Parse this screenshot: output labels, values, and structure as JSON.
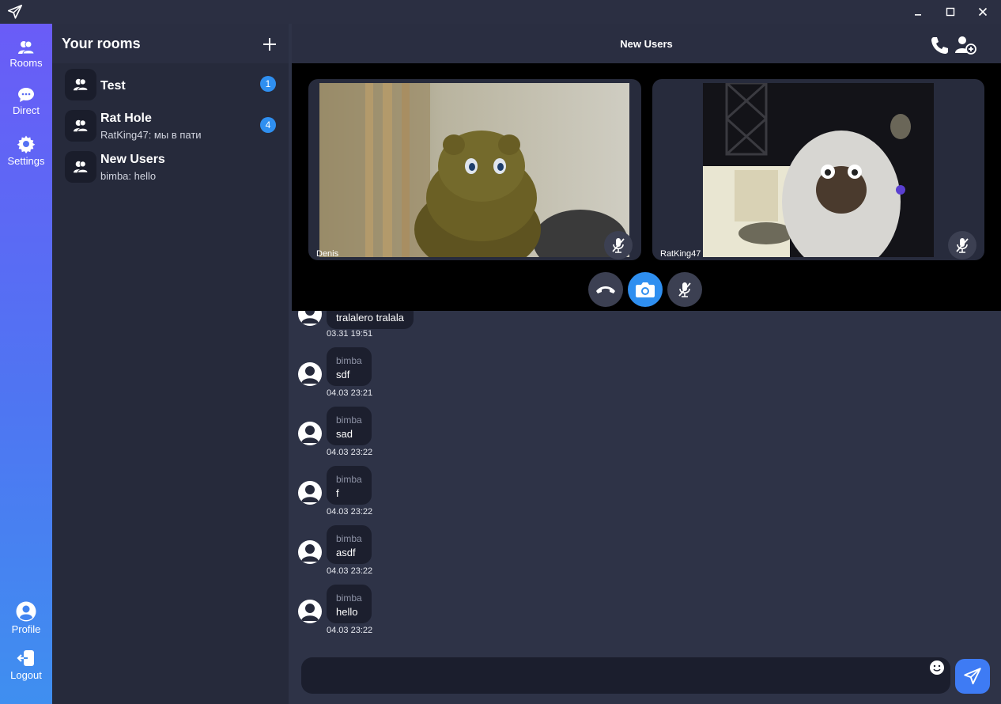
{
  "nav": {
    "items": [
      {
        "label": "Rooms",
        "icon": "users-icon"
      },
      {
        "label": "Direct",
        "icon": "chat-bubble-icon"
      },
      {
        "label": "Settings",
        "icon": "gear-icon"
      },
      {
        "label": "Profile",
        "icon": "user-circle-icon"
      },
      {
        "label": "Logout",
        "icon": "logout-icon"
      }
    ]
  },
  "rooms": {
    "title": "Your rooms",
    "list": [
      {
        "name": "Test",
        "preview": "",
        "unread": "1"
      },
      {
        "name": "Rat Hole",
        "preview": "RatKing47: мы в пати",
        "unread": "4"
      },
      {
        "name": "New Users",
        "preview": "bimba: hello",
        "unread": ""
      }
    ]
  },
  "chat": {
    "title": "New Users",
    "call": {
      "participants": [
        {
          "name": "Denis",
          "muted": true
        },
        {
          "name": "RatKing47",
          "muted": true
        }
      ]
    },
    "messages": [
      {
        "sender": "",
        "text": "tralalero tralala",
        "time": "03.31 19:51"
      },
      {
        "sender": "bimba",
        "text": "sdf",
        "time": "04.03 23:21"
      },
      {
        "sender": "bimba",
        "text": "sad",
        "time": "04.03 23:22"
      },
      {
        "sender": "bimba",
        "text": "f",
        "time": "04.03 23:22"
      },
      {
        "sender": "bimba",
        "text": "asdf",
        "time": "04.03 23:22"
      },
      {
        "sender": "bimba",
        "text": "hello",
        "time": "04.03 23:22"
      }
    ],
    "composer": {
      "placeholder": ""
    }
  },
  "colors": {
    "nav_gradient_top": "#6a5cf7",
    "nav_gradient_bottom": "#3f8ff0",
    "accent": "#2f8ff0",
    "bg": "#2e3347",
    "panel": "#262a3b"
  }
}
